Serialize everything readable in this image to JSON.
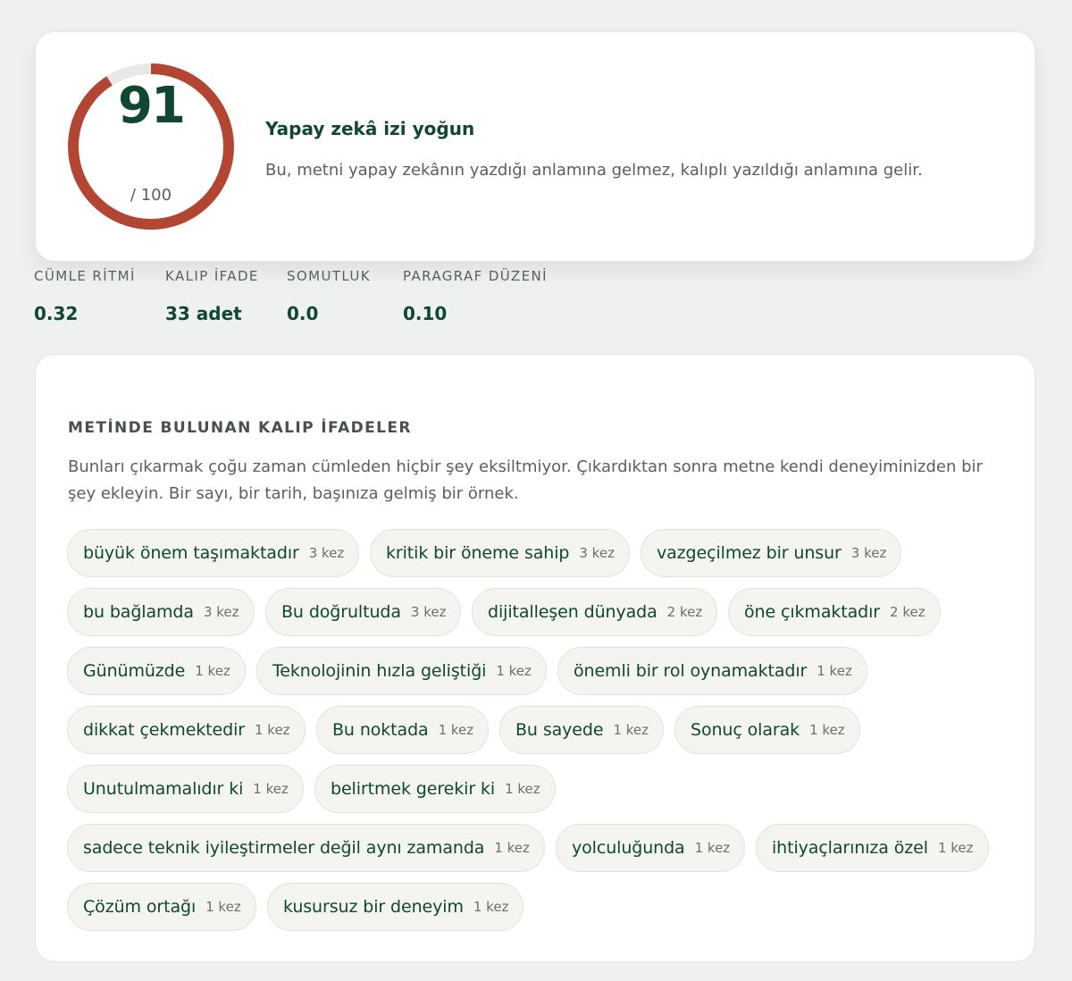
{
  "score": {
    "value": "91",
    "max_label": "/ 100",
    "fraction": 0.91,
    "arc_color": "#b24633",
    "track_color": "#e7e9e6"
  },
  "verdict": {
    "title": "Yapay zekâ izi yoğun",
    "description": "Bu, metni yapay zekânın yazdığı anlamına gelmez, kalıplı yazıldığı anlamına gelir."
  },
  "metrics": [
    {
      "label": "CÜMLE RİTMİ",
      "value": "0.32"
    },
    {
      "label": "KALIP İFADE",
      "value": "33 adet"
    },
    {
      "label": "SOMUTLUK",
      "value": "0.0"
    },
    {
      "label": "PARAGRAF DÜZENİ",
      "value": "0.10"
    }
  ],
  "phrases": {
    "heading": "METİNDE BULUNAN KALIP İFADELER",
    "intro": "Bunları çıkarmak çoğu zaman cümleden hiçbir şey eksiltmiyor. Çıkardıktan sonra metne kendi deneyiminizden bir şey ekleyin. Bir sayı, bir tarih, başınıza gelmiş bir örnek.",
    "items": [
      {
        "text": "büyük önem taşımaktadır",
        "count": "3 kez"
      },
      {
        "text": "kritik bir öneme sahip",
        "count": "3 kez"
      },
      {
        "text": "vazgeçilmez bir unsur",
        "count": "3 kez"
      },
      {
        "text": "bu bağlamda",
        "count": "3 kez"
      },
      {
        "text": "Bu doğrultuda",
        "count": "3 kez"
      },
      {
        "text": "dijitalleşen dünyada",
        "count": "2 kez"
      },
      {
        "text": "öne çıkmaktadır",
        "count": "2 kez"
      },
      {
        "text": "Günümüzde",
        "count": "1 kez"
      },
      {
        "text": "Teknolojinin hızla geliştiği",
        "count": "1 kez"
      },
      {
        "text": "önemli bir rol oynamaktadır",
        "count": "1 kez"
      },
      {
        "text": "dikkat çekmektedir",
        "count": "1 kez"
      },
      {
        "text": "Bu noktada",
        "count": "1 kez"
      },
      {
        "text": "Bu sayede",
        "count": "1 kez"
      },
      {
        "text": "Sonuç olarak",
        "count": "1 kez"
      },
      {
        "text": "Unutulmamalıdır ki",
        "count": "1 kez"
      },
      {
        "text": "belirtmek gerekir ki",
        "count": "1 kez"
      },
      {
        "text": "sadece teknik iyileştirmeler değil aynı zamanda",
        "count": "1 kez"
      },
      {
        "text": "yolculuğunda",
        "count": "1 kez"
      },
      {
        "text": "ihtiyaçlarınıza özel",
        "count": "1 kez"
      },
      {
        "text": "Çözüm ortağı",
        "count": "1 kez"
      },
      {
        "text": "kusursuz bir deneyim",
        "count": "1 kez"
      }
    ]
  }
}
